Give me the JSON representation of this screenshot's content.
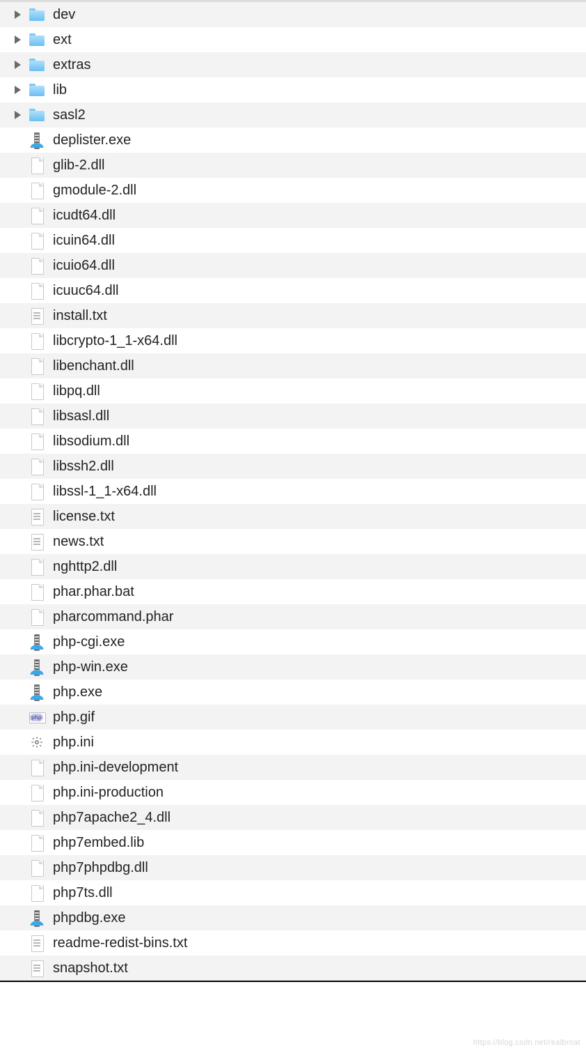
{
  "tree": {
    "items": [
      {
        "name": "dev",
        "type": "folder",
        "expandable": true
      },
      {
        "name": "ext",
        "type": "folder",
        "expandable": true
      },
      {
        "name": "extras",
        "type": "folder",
        "expandable": true
      },
      {
        "name": "lib",
        "type": "folder",
        "expandable": true
      },
      {
        "name": "sasl2",
        "type": "folder",
        "expandable": true
      },
      {
        "name": "deplister.exe",
        "type": "exe",
        "expandable": false
      },
      {
        "name": "glib-2.dll",
        "type": "file",
        "expandable": false
      },
      {
        "name": "gmodule-2.dll",
        "type": "file",
        "expandable": false
      },
      {
        "name": "icudt64.dll",
        "type": "file",
        "expandable": false
      },
      {
        "name": "icuin64.dll",
        "type": "file",
        "expandable": false
      },
      {
        "name": "icuio64.dll",
        "type": "file",
        "expandable": false
      },
      {
        "name": "icuuc64.dll",
        "type": "file",
        "expandable": false
      },
      {
        "name": "install.txt",
        "type": "text",
        "expandable": false
      },
      {
        "name": "libcrypto-1_1-x64.dll",
        "type": "file",
        "expandable": false
      },
      {
        "name": "libenchant.dll",
        "type": "file",
        "expandable": false
      },
      {
        "name": "libpq.dll",
        "type": "file",
        "expandable": false
      },
      {
        "name": "libsasl.dll",
        "type": "file",
        "expandable": false
      },
      {
        "name": "libsodium.dll",
        "type": "file",
        "expandable": false
      },
      {
        "name": "libssh2.dll",
        "type": "file",
        "expandable": false
      },
      {
        "name": "libssl-1_1-x64.dll",
        "type": "file",
        "expandable": false
      },
      {
        "name": "license.txt",
        "type": "text",
        "expandable": false
      },
      {
        "name": "news.txt",
        "type": "text",
        "expandable": false
      },
      {
        "name": "nghttp2.dll",
        "type": "file",
        "expandable": false
      },
      {
        "name": "phar.phar.bat",
        "type": "file",
        "expandable": false
      },
      {
        "name": "pharcommand.phar",
        "type": "file",
        "expandable": false
      },
      {
        "name": "php-cgi.exe",
        "type": "exe",
        "expandable": false
      },
      {
        "name": "php-win.exe",
        "type": "exe",
        "expandable": false
      },
      {
        "name": "php.exe",
        "type": "exe",
        "expandable": false
      },
      {
        "name": "php.gif",
        "type": "gif",
        "expandable": false
      },
      {
        "name": "php.ini",
        "type": "ini",
        "expandable": false
      },
      {
        "name": "php.ini-development",
        "type": "file",
        "expandable": false
      },
      {
        "name": "php.ini-production",
        "type": "file",
        "expandable": false
      },
      {
        "name": "php7apache2_4.dll",
        "type": "file",
        "expandable": false
      },
      {
        "name": "php7embed.lib",
        "type": "file",
        "expandable": false
      },
      {
        "name": "php7phpdbg.dll",
        "type": "file",
        "expandable": false
      },
      {
        "name": "php7ts.dll",
        "type": "file",
        "expandable": false
      },
      {
        "name": "phpdbg.exe",
        "type": "exe",
        "expandable": false
      },
      {
        "name": "readme-redist-bins.txt",
        "type": "text",
        "expandable": false
      },
      {
        "name": "snapshot.txt",
        "type": "text",
        "expandable": false
      }
    ]
  },
  "watermark": "https://blog.csdn.net/realbroat"
}
